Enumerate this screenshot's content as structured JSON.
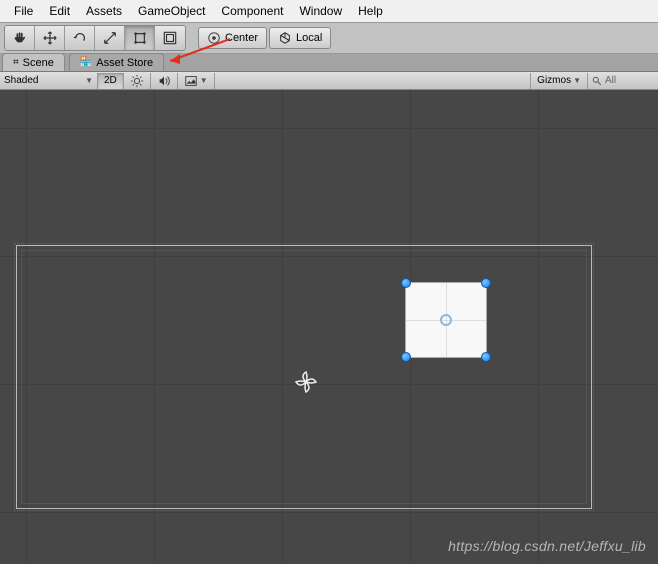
{
  "menu": {
    "file": "File",
    "edit": "Edit",
    "assets": "Assets",
    "gameobject": "GameObject",
    "component": "Component",
    "window": "Window",
    "help": "Help"
  },
  "toolbar": {
    "center": "Center",
    "local": "Local"
  },
  "tabs": {
    "scene": "Scene",
    "asset_store": "Asset Store"
  },
  "scene_toolbar": {
    "shaded": "Shaded",
    "two_d": "2D",
    "gizmos": "Gizmos",
    "search_placeholder": "All"
  },
  "watermark": "https://blog.csdn.net/Jeffxu_lib"
}
